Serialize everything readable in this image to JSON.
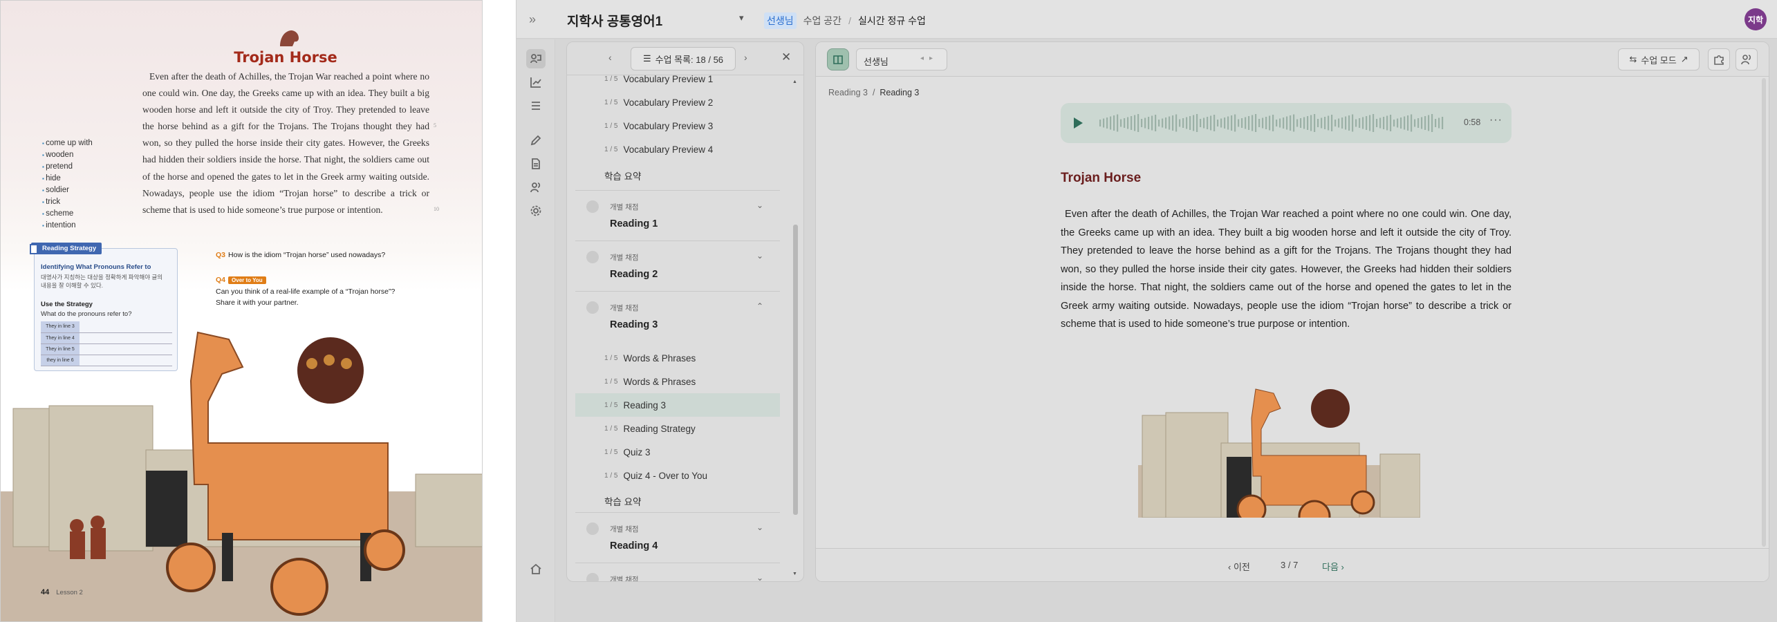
{
  "textbook": {
    "title": "Trojan Horse",
    "body": "Even after the death of Achilles, the Trojan War reached a point where no one could win. One day, the Greeks came up with an idea. They built a big wooden horse and left it outside the city of Troy. They pretended to leave the horse behind as a gift for the Trojans. The Trojans thought they had won, so they pulled the horse inside their city gates. However, the Greeks had hidden their soldiers inside the horse. That night, the soldiers came out of the horse and opened the gates to let in the Greek army waiting outside. Nowadays, people use the idiom “Trojan horse” to describe a trick or scheme that is used to hide someone’s true purpose or intention.",
    "line_numbers": [
      "5",
      "10"
    ],
    "vocab": [
      "come up with",
      "wooden",
      "pretend",
      "hide",
      "soldier",
      "trick",
      "scheme",
      "intention"
    ],
    "strategy": {
      "tag": "Reading Strategy",
      "subtitle": "Identifying What Pronouns Refer to",
      "korean": "대명사가 지칭하는 대상을 정확하게 파악해야 글의 내용을 잘 이해할 수 있다.",
      "use_heading": "Use the Strategy",
      "question": "What do the pronouns refer to?",
      "rows": [
        "They in line 3",
        "They in line 4",
        "They in line 5",
        "they in line 6"
      ]
    },
    "q3": {
      "label": "Q3",
      "text": "How is the idiom “Trojan horse” used nowadays?"
    },
    "q4": {
      "label": "Q4",
      "tag": "Over to You",
      "text": "Can you think of a real-life example of a “Trojan horse”? Share it with your partner."
    },
    "page_number": "44",
    "lesson": "Lesson 2"
  },
  "app": {
    "title": "지학사 공통영어1",
    "breadcrumbs": {
      "teacher": "선생님",
      "space": "수업 공간",
      "current": "실시간 정규 수업"
    },
    "avatar": "지학",
    "rail_icons": [
      "teach-icon",
      "chart-icon",
      "list-icon",
      "pen-icon",
      "document-icon",
      "people-icon",
      "settings-icon",
      "home-icon"
    ],
    "lesson_list": {
      "count_label": "수업 목록: 18 / 56",
      "items_top": [
        {
          "n": "1 / 5",
          "label": "Vocabulary Preview 1"
        },
        {
          "n": "1 / 5",
          "label": "Vocabulary Preview 2"
        },
        {
          "n": "1 / 5",
          "label": "Vocabulary Preview 3"
        },
        {
          "n": "1 / 5",
          "label": "Vocabulary Preview 4"
        }
      ],
      "summary_label": "학습 요약",
      "group_label": "개별 채점",
      "groups": [
        "Reading 1",
        "Reading 2",
        "Reading 3",
        "Reading 4"
      ],
      "reading3_items": [
        {
          "n": "1 / 5",
          "label": "Words & Phrases"
        },
        {
          "n": "1 / 5",
          "label": "Words & Phrases"
        },
        {
          "n": "1 / 5",
          "label": "Reading 3"
        },
        {
          "n": "1 / 5",
          "label": "Reading Strategy"
        },
        {
          "n": "1 / 5",
          "label": "Quiz 3"
        },
        {
          "n": "1 / 5",
          "label": "Quiz 4 - Over to You"
        }
      ],
      "selected_index": 2
    },
    "content": {
      "role_select": "선생님",
      "mode_button": "수업 모드",
      "breadcrumb": [
        "Reading 3",
        "Reading 3"
      ],
      "audio_time": "0:58",
      "reading_title": "Trojan Horse",
      "reading_body": "Even after the death of Achilles, the Trojan War reached a point where no one could win. One day, the Greeks came up with an idea. They built a big wooden horse and left it outside the city of Troy. They pretended to leave the horse behind as a gift for the Trojans. The Trojans thought they had won, so they pulled the horse inside their city gates. However, the Greeks had hidden their soldiers inside the horse. That night, the soldiers came out of the horse and opened the gates to let in the Greek army waiting outside. Nowadays, people use the idiom “Trojan horse” to describe a trick or scheme that is used to hide someone’s true purpose or intention.",
      "prev_label": "이전",
      "page_label": "3 / 7",
      "next_label": "다음"
    },
    "colors": {
      "accent_green": "#2f6d5a",
      "title_red": "#a32a1a",
      "avatar": "#7b3a8a"
    }
  }
}
